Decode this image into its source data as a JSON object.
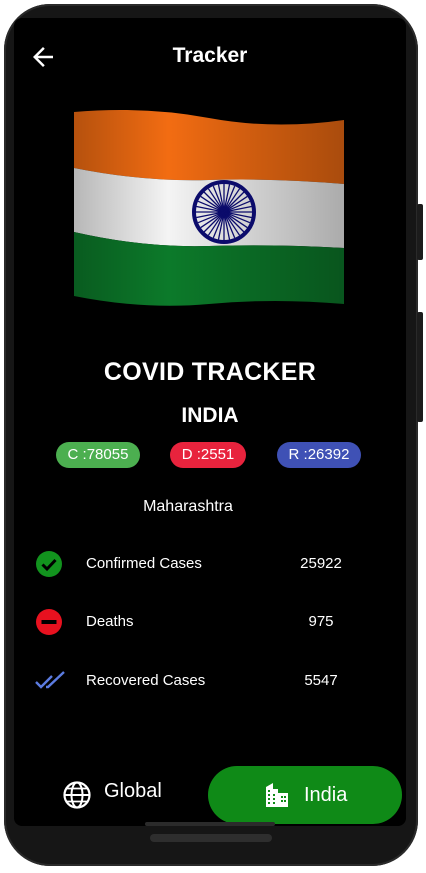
{
  "app": {
    "title": "Tracker"
  },
  "main": {
    "heading": "COVID TRACKER",
    "country": "INDIA",
    "pills": {
      "confirmed": "C :78055",
      "deaths": "D :2551",
      "recovered": "R :26392"
    },
    "state": "Maharashtra",
    "stats": [
      {
        "label": "Confirmed Cases",
        "value": "25922",
        "icon": "check-circle-icon"
      },
      {
        "label": "Deaths",
        "value": "975",
        "icon": "minus-circle-icon"
      },
      {
        "label": "Recovered Cases",
        "value": "5547",
        "icon": "double-check-icon"
      }
    ]
  },
  "bottom_nav": {
    "global_label": "Global",
    "india_label": "India",
    "active": "India"
  },
  "colors": {
    "confirmed": "#4caf50",
    "deaths": "#e8233d",
    "recovered": "#3f51b5",
    "active_tab": "#0f8a17",
    "saffron": "#f26c12",
    "green": "#0c7a2a"
  }
}
